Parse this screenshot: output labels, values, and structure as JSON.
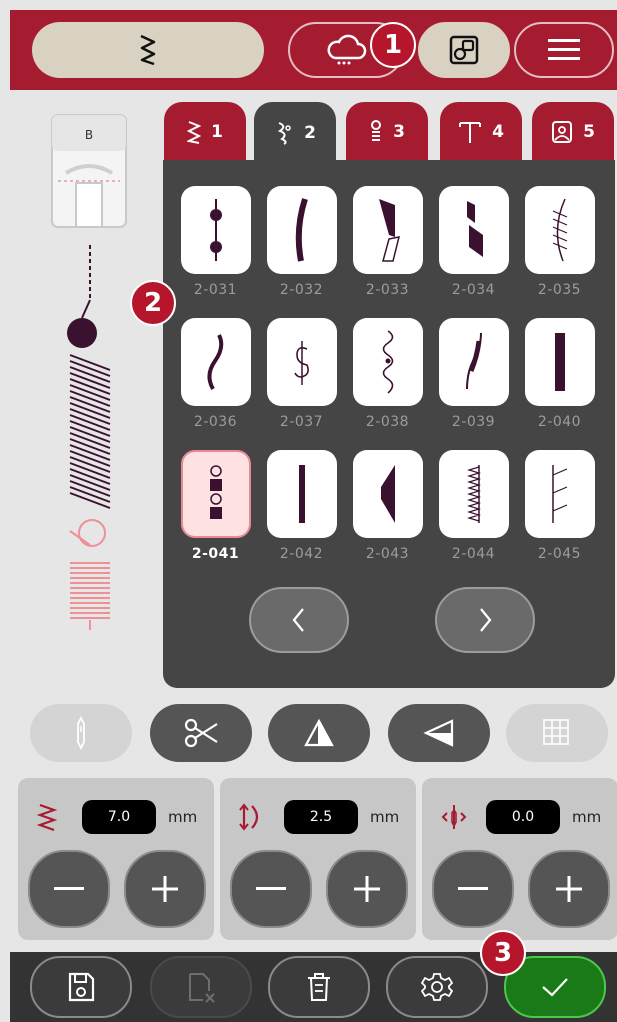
{
  "colors": {
    "brand_red": "#a51c30",
    "dark_panel": "#454545",
    "confirm_green": "#1a7a18"
  },
  "callouts": [
    "1",
    "2",
    "3"
  ],
  "foot": {
    "label": "B"
  },
  "tabs": [
    {
      "icon": "zigzag-stitch-icon",
      "label": "1",
      "active": false
    },
    {
      "icon": "decorative-stitch-icon",
      "label": "2",
      "active": true
    },
    {
      "icon": "quilt-stitch-icon",
      "label": "3",
      "active": false
    },
    {
      "icon": "text-font-icon",
      "label": "4",
      "active": false
    },
    {
      "icon": "image-stitch-icon",
      "label": "5",
      "active": false
    }
  ],
  "stitches": [
    {
      "label": "2-031"
    },
    {
      "label": "2-032"
    },
    {
      "label": "2-033"
    },
    {
      "label": "2-034"
    },
    {
      "label": "2-035"
    },
    {
      "label": "2-036"
    },
    {
      "label": "2-037"
    },
    {
      "label": "2-038"
    },
    {
      "label": "2-039"
    },
    {
      "label": "2-040"
    },
    {
      "label": "2-041",
      "selected": true
    },
    {
      "label": "2-042"
    },
    {
      "label": "2-043"
    },
    {
      "label": "2-044"
    },
    {
      "label": "2-045"
    }
  ],
  "adjustments": [
    {
      "icon": "stitch-width-icon",
      "value": "7.0",
      "unit": "mm"
    },
    {
      "icon": "stitch-length-icon",
      "value": "2.5",
      "unit": "mm"
    },
    {
      "icon": "stitch-position-icon",
      "value": "0.0",
      "unit": "mm"
    }
  ],
  "tools": [
    "needle-icon",
    "scissors-icon",
    "mirror-side-icon",
    "mirror-end-icon",
    "grid-icon"
  ],
  "bottom": [
    "save-icon",
    "delete-file-icon",
    "trash-icon",
    "settings-icon",
    "checkmark-icon"
  ]
}
